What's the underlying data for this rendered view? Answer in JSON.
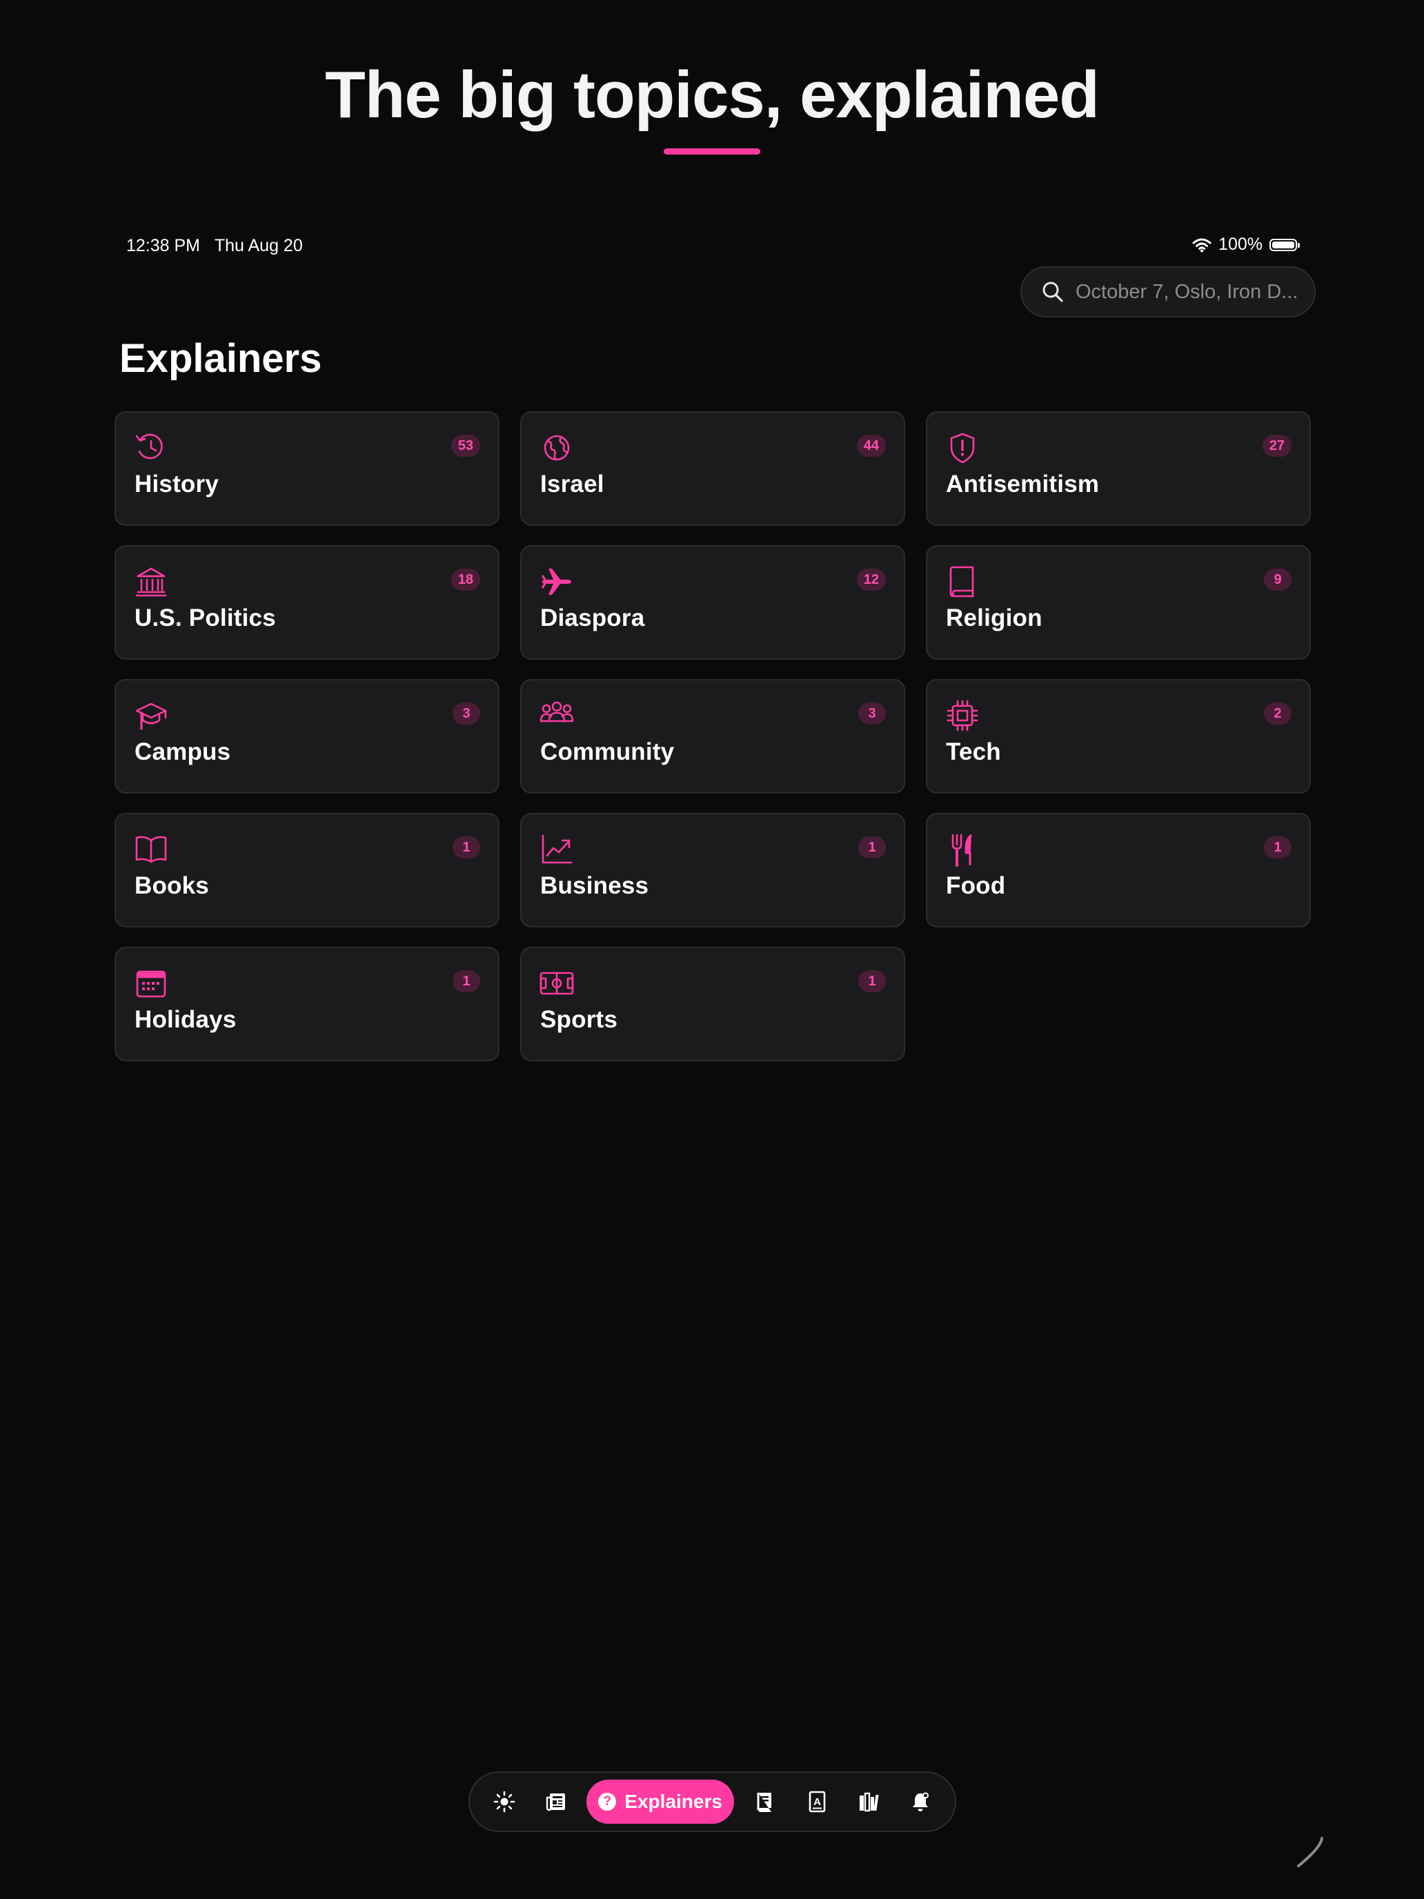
{
  "hero": {
    "title": "The big topics, explained"
  },
  "status_bar": {
    "time": "12:38 PM",
    "date": "Thu Aug 20",
    "battery": "100%"
  },
  "search": {
    "placeholder": "October 7, Oslo, Iron D..."
  },
  "page": {
    "title": "Explainers"
  },
  "topics": [
    {
      "label": "History",
      "count": "53",
      "icon": "history-icon"
    },
    {
      "label": "Israel",
      "count": "44",
      "icon": "globe-icon"
    },
    {
      "label": "Antisemitism",
      "count": "27",
      "icon": "shield-alert-icon"
    },
    {
      "label": "U.S. Politics",
      "count": "18",
      "icon": "government-building-icon"
    },
    {
      "label": "Diaspora",
      "count": "12",
      "icon": "airplane-icon"
    },
    {
      "label": "Religion",
      "count": "9",
      "icon": "book-icon"
    },
    {
      "label": "Campus",
      "count": "3",
      "icon": "graduation-cap-icon"
    },
    {
      "label": "Community",
      "count": "3",
      "icon": "people-icon"
    },
    {
      "label": "Tech",
      "count": "2",
      "icon": "chip-icon"
    },
    {
      "label": "Books",
      "count": "1",
      "icon": "open-book-icon"
    },
    {
      "label": "Business",
      "count": "1",
      "icon": "chart-trend-icon"
    },
    {
      "label": "Food",
      "count": "1",
      "icon": "fork-knife-icon"
    },
    {
      "label": "Holidays",
      "count": "1",
      "icon": "calendar-icon"
    },
    {
      "label": "Sports",
      "count": "1",
      "icon": "soccer-field-icon"
    }
  ],
  "tabbar": {
    "active_label": "Explainers",
    "items": [
      "sun-icon",
      "newspaper-icon",
      "help-circle-icon",
      "book-icon",
      "dictionary-icon",
      "library-icon",
      "bell-icon"
    ]
  },
  "colors": {
    "accent": "#ff3aa1",
    "background": "#0a0a0a",
    "card": "#1b1b1d",
    "badge_bg": "#4a1d36"
  }
}
